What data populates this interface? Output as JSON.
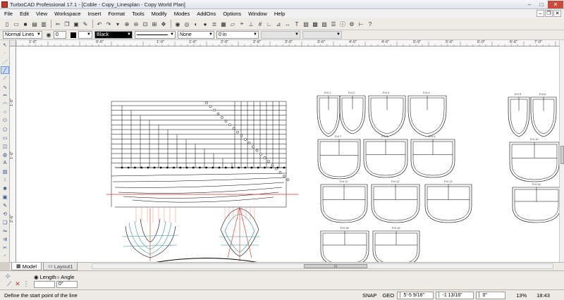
{
  "window": {
    "title": "TurboCAD Professional 17.1 - [Coble - Copy_Linesplan - Copy World Plan]"
  },
  "menu": [
    "File",
    "Edit",
    "View",
    "Workspace",
    "Insert",
    "Format",
    "Tools",
    "Modify",
    "Modes",
    "AddOns",
    "Options",
    "Window",
    "Help"
  ],
  "properties": {
    "layer": "Normal Lines",
    "count": "0",
    "color": "Black",
    "pattern": "None",
    "width": "0 in"
  },
  "ruler": {
    "top": [
      "1'-0\"",
      "0'-6\"",
      "1'-0\"",
      "1'-6\"",
      "2'-0\"",
      "2'-6\"",
      "3'-0\"",
      "3'-6\"",
      "4'-0\"",
      "4'-6\"",
      "5'-0\"",
      "5'-6\"",
      "6'-0\"",
      "6'-6\"",
      "7'-0\""
    ],
    "left": [
      "1'-6\"",
      "1'-0\"",
      "2'-6\""
    ]
  },
  "sheet_labels": [
    "Fr4 1",
    "Fr4 2",
    "Fr4 3",
    "Fr4 4",
    "Fr4 5",
    "Fr4 6",
    "Fr4 7",
    "Fr4 8",
    "Fr4 9",
    "Fr4 10",
    "Fr4 11",
    "Fr4 12",
    "Fr4 13",
    "Fr4 14",
    "Fr4 15",
    "Fr4 16"
  ],
  "tabs": [
    {
      "label": "Model",
      "active": true
    },
    {
      "label": "Layout1",
      "active": false
    }
  ],
  "scroll_label": "III",
  "inspector": {
    "length_label": "Length",
    "angle_label": "Angle",
    "length_value": "",
    "angle_value": "0°"
  },
  "status": {
    "prompt": "Define the start point of the line",
    "snap": "SNAP",
    "geo": "GEO",
    "x": "5'-5 9/16\"",
    "y": "-1 13/16\"",
    "z": "0\"",
    "zoom": "13%",
    "time": "18:43"
  },
  "colors": {
    "accent_red": "#c0392b",
    "teal": "#2e8b8b",
    "canvas": "#ffffff"
  }
}
